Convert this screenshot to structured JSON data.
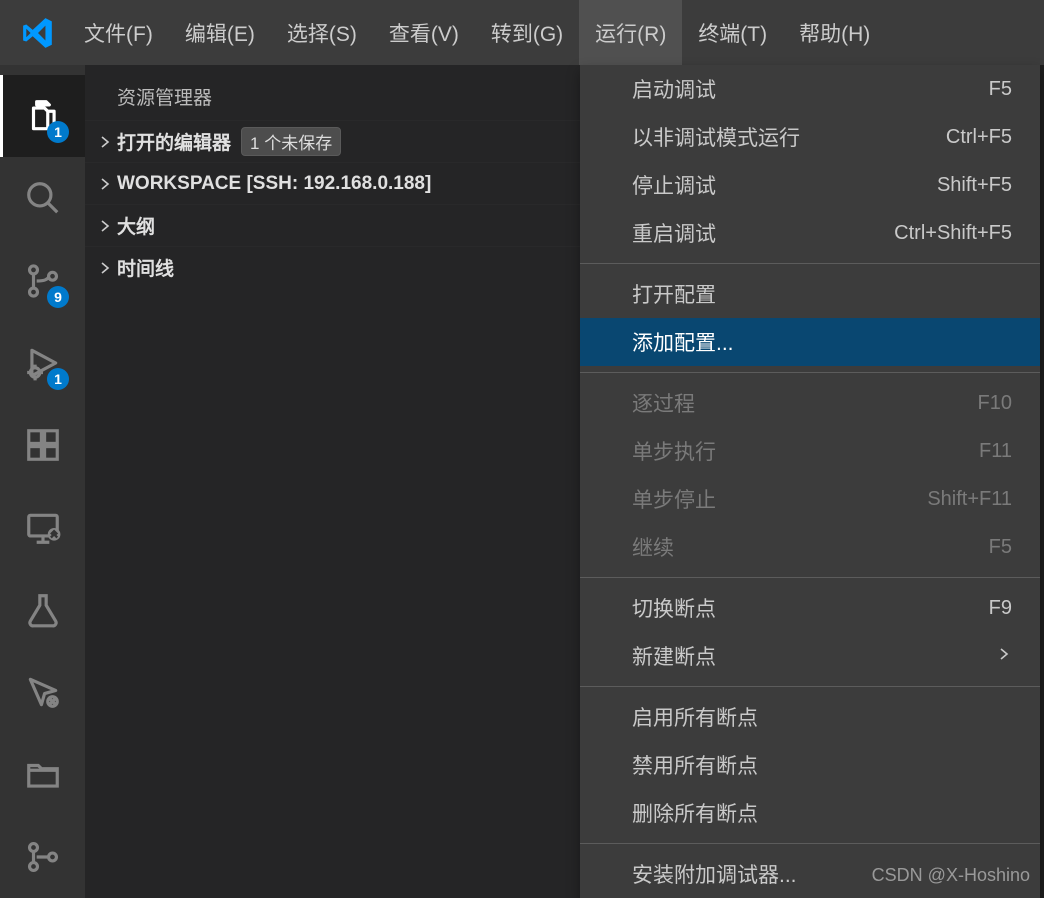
{
  "menubar": {
    "items": [
      "文件(F)",
      "编辑(E)",
      "选择(S)",
      "查看(V)",
      "转到(G)",
      "运行(R)",
      "终端(T)",
      "帮助(H)"
    ],
    "openIndex": 5
  },
  "activitybar": {
    "items": [
      {
        "name": "explorer-icon",
        "badge": "1",
        "active": true
      },
      {
        "name": "search-icon"
      },
      {
        "name": "source-control-icon",
        "badge": "9"
      },
      {
        "name": "run-debug-icon",
        "badge": "1"
      },
      {
        "name": "extensions-icon"
      },
      {
        "name": "remote-explorer-icon"
      },
      {
        "name": "testing-icon"
      },
      {
        "name": "live-share-icon"
      },
      {
        "name": "folder-icon"
      },
      {
        "name": "git-graph-icon"
      }
    ]
  },
  "explorer": {
    "title": "资源管理器",
    "sections": [
      {
        "label": "打开的编辑器",
        "tag": "1 个未保存"
      },
      {
        "label": "WORKSPACE [SSH: 192.168.0.188]"
      },
      {
        "label": "大纲"
      },
      {
        "label": "时间线"
      }
    ]
  },
  "runMenu": {
    "groups": [
      [
        {
          "label": "启动调试",
          "kb": "F5"
        },
        {
          "label": "以非调试模式运行",
          "kb": "Ctrl+F5"
        },
        {
          "label": "停止调试",
          "kb": "Shift+F5"
        },
        {
          "label": "重启调试",
          "kb": "Ctrl+Shift+F5"
        }
      ],
      [
        {
          "label": "打开配置"
        },
        {
          "label": "添加配置...",
          "selected": true
        }
      ],
      [
        {
          "label": "逐过程",
          "kb": "F10",
          "disabled": true
        },
        {
          "label": "单步执行",
          "kb": "F11",
          "disabled": true
        },
        {
          "label": "单步停止",
          "kb": "Shift+F11",
          "disabled": true
        },
        {
          "label": "继续",
          "kb": "F5",
          "disabled": true
        }
      ],
      [
        {
          "label": "切换断点",
          "kb": "F9"
        },
        {
          "label": "新建断点",
          "submenu": true
        }
      ],
      [
        {
          "label": "启用所有断点"
        },
        {
          "label": "禁用所有断点"
        },
        {
          "label": "删除所有断点"
        }
      ],
      [
        {
          "label": "安装附加调试器..."
        }
      ]
    ]
  },
  "watermark": "CSDN @X-Hoshino"
}
